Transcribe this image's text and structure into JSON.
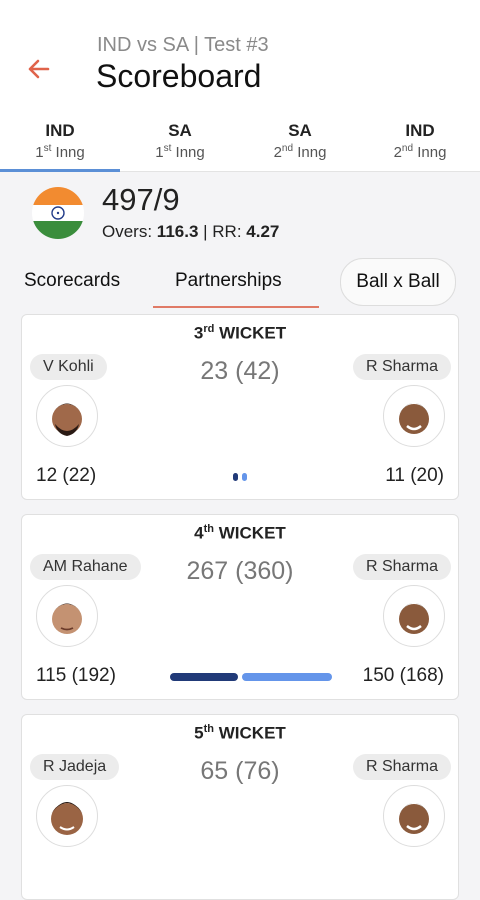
{
  "header": {
    "subtitle": "IND vs SA | Test #3",
    "title": "Scoreboard",
    "accent_color": "#e0634a"
  },
  "innings_tabs": [
    {
      "team": "IND",
      "num": "1",
      "sup": "st",
      "label": " Inng",
      "active": true
    },
    {
      "team": "SA",
      "num": "1",
      "sup": "st",
      "label": " Inng",
      "active": false
    },
    {
      "team": "SA",
      "num": "2",
      "sup": "nd",
      "label": " Inng",
      "active": false
    },
    {
      "team": "IND",
      "num": "2",
      "sup": "nd",
      "label": " Inng",
      "active": false
    }
  ],
  "score": {
    "flag_icon": "india-flag-icon",
    "runs": "497/9",
    "overs_label": "Overs: ",
    "overs_value": "116.3",
    "separator": " | ",
    "rr_label": "RR: ",
    "rr_value": "4.27"
  },
  "section_tabs": {
    "scorecards": "Scorecards",
    "partnerships": "Partnerships",
    "ball_by_ball": "Ball x Ball",
    "active": "partnerships"
  },
  "partnerships": [
    {
      "wicket_num": "3",
      "wicket_sup": "rd",
      "wicket_label": " WICKET",
      "left_name": "V Kohli",
      "right_name": "R Sharma",
      "total": "23 (42)",
      "left_score": "12 (22)",
      "right_score": "11 (20)",
      "left_runs": 12,
      "right_runs": 11
    },
    {
      "wicket_num": "4",
      "wicket_sup": "th",
      "wicket_label": " WICKET",
      "left_name": "AM Rahane",
      "right_name": "R Sharma",
      "total": "267 (360)",
      "left_score": "115 (192)",
      "right_score": "150 (168)",
      "left_runs": 115,
      "right_runs": 150
    },
    {
      "wicket_num": "5",
      "wicket_sup": "th",
      "wicket_label": " WICKET",
      "left_name": "R Jadeja",
      "right_name": "R Sharma",
      "total": "65 (76)",
      "left_score": "",
      "right_score": "",
      "left_runs": null,
      "right_runs": null
    }
  ],
  "colors": {
    "left_bar": "#213a78",
    "right_bar": "#6495ea",
    "active_tab_indicator": "#5b8fd6",
    "section_underline": "#e07a66"
  }
}
